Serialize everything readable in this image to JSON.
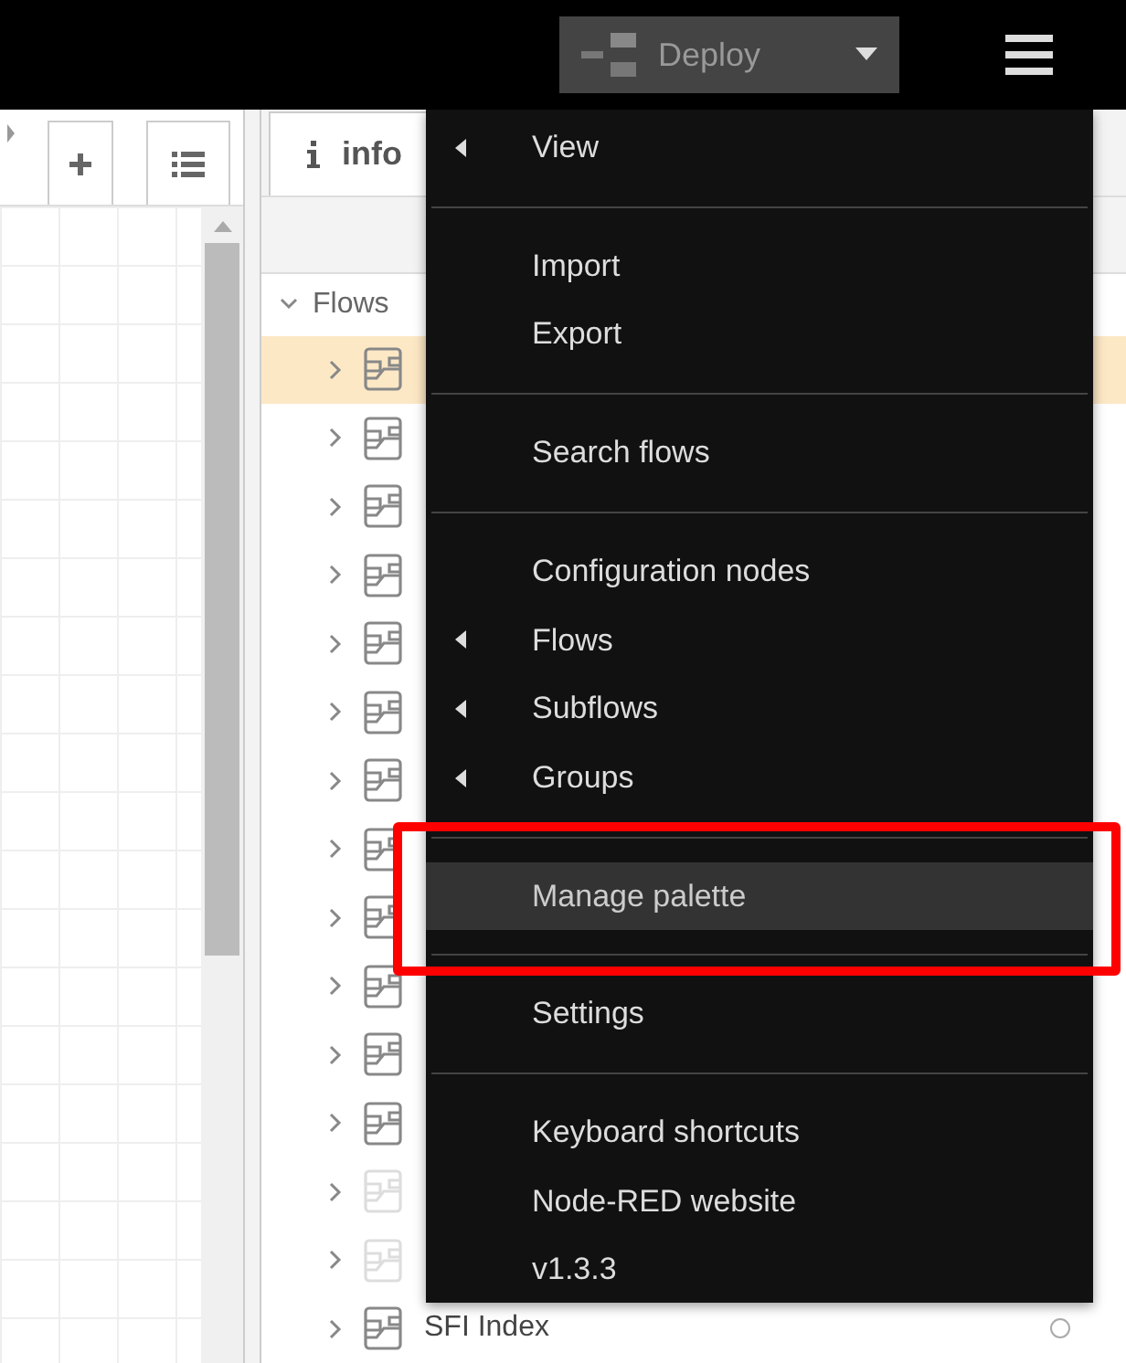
{
  "header": {
    "deploy": {
      "label": "Deploy",
      "disabled": true
    }
  },
  "workspace": {
    "tab_buttons": [
      {
        "kind": "add"
      },
      {
        "kind": "list"
      }
    ]
  },
  "sidebar": {
    "tab": {
      "label": "info",
      "selected": true
    },
    "tree": {
      "label": "Flows",
      "expanded": true,
      "children": [
        {
          "selected": true,
          "disabled": false
        },
        {
          "selected": false,
          "disabled": false
        },
        {
          "selected": false,
          "disabled": false
        },
        {
          "selected": false,
          "disabled": false
        },
        {
          "selected": false,
          "disabled": false
        },
        {
          "selected": false,
          "disabled": false
        },
        {
          "selected": false,
          "disabled": false
        },
        {
          "selected": false,
          "disabled": false
        },
        {
          "selected": false,
          "disabled": false
        },
        {
          "selected": false,
          "disabled": false
        },
        {
          "selected": false,
          "disabled": false
        },
        {
          "selected": false,
          "disabled": false
        },
        {
          "selected": false,
          "disabled": true
        },
        {
          "selected": false,
          "disabled": true
        },
        {
          "selected": false,
          "disabled": false,
          "label": "SFI Index"
        }
      ]
    }
  },
  "menu": {
    "items": [
      {
        "kind": "item",
        "label": "View",
        "submenu": true,
        "selected": false
      },
      {
        "kind": "separator"
      },
      {
        "kind": "item",
        "label": "Import",
        "submenu": false,
        "selected": false
      },
      {
        "kind": "item",
        "label": "Export",
        "submenu": false,
        "selected": false
      },
      {
        "kind": "separator"
      },
      {
        "kind": "item",
        "label": "Search flows",
        "submenu": false,
        "selected": false
      },
      {
        "kind": "separator"
      },
      {
        "kind": "item",
        "label": "Configuration nodes",
        "submenu": false,
        "selected": false
      },
      {
        "kind": "item",
        "label": "Flows",
        "submenu": true,
        "selected": false
      },
      {
        "kind": "item",
        "label": "Subflows",
        "submenu": true,
        "selected": false
      },
      {
        "kind": "item",
        "label": "Groups",
        "submenu": true,
        "selected": false
      },
      {
        "kind": "separator"
      },
      {
        "kind": "item",
        "label": "Manage palette",
        "submenu": false,
        "selected": true
      },
      {
        "kind": "separator"
      },
      {
        "kind": "item",
        "label": "Settings",
        "submenu": false,
        "selected": false
      },
      {
        "kind": "separator"
      },
      {
        "kind": "item",
        "label": "Keyboard shortcuts",
        "submenu": false,
        "selected": false
      },
      {
        "kind": "item",
        "label": "Node-RED website",
        "submenu": false,
        "selected": false
      },
      {
        "kind": "item",
        "label": "v1.3.3",
        "submenu": false,
        "selected": false
      }
    ]
  }
}
